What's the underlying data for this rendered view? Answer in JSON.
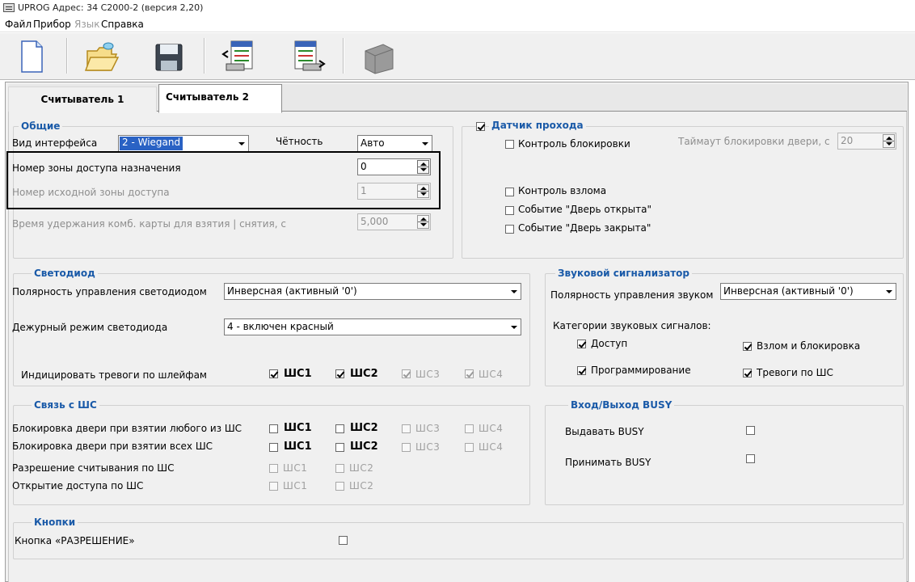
{
  "window": {
    "title": "UPROG Адрес: 34 С2000-2 (версия 2,20)"
  },
  "menu": [
    "Файл",
    "Прибор",
    "Язык",
    "Справка"
  ],
  "toolbar": {
    "buttons": [
      "new-document-icon",
      "open-folder-icon",
      "save-floppy-icon",
      "read-device-icon",
      "write-device-icon",
      "device-icon"
    ]
  },
  "tabs": [
    "Считыватель 1",
    "Считыватель 2"
  ],
  "general": {
    "title": "Общие",
    "interface_label": "Вид интерфейса",
    "interface_value": "2 - Wiegand",
    "parity_label": "Чётность",
    "parity_value": "Авто",
    "dest_zone_label": "Номер зоны доступа назначения",
    "dest_zone_value": "0",
    "src_zone_label": "Номер исходной зоны доступа",
    "src_zone_value": "1",
    "hold_time_label": "Время удержания комб. карты для взятия | снятия, с",
    "hold_time_value": "5,000"
  },
  "door_sensor": {
    "title": "Датчик прохода",
    "checked": true,
    "block_control": "Контроль блокировки",
    "timeout_label": "Таймаут блокировки двери, с",
    "timeout_value": "20",
    "break_control": "Контроль взлома",
    "event_open": "Событие \"Дверь открыта\"",
    "event_closed": "Событие \"Дверь закрыта\""
  },
  "led": {
    "title": "Светодиод",
    "polarity_label": "Полярность управления светодиодом",
    "polarity_value": "Инверсная (активный '0')",
    "standby_label": "Дежурный режим светодиода",
    "standby_value": "4 - включен красный",
    "alarms_label": "Индицировать тревоги по шлейфам",
    "loops": [
      {
        "label": "ШС1",
        "checked": true,
        "enabled": true
      },
      {
        "label": "ШС2",
        "checked": true,
        "enabled": true
      },
      {
        "label": "ШС3",
        "checked": true,
        "enabled": false
      },
      {
        "label": "ШС4",
        "checked": true,
        "enabled": false
      }
    ]
  },
  "buzzer": {
    "title": "Звуковой сигнализатор",
    "polarity_label": "Полярность управления звуком",
    "polarity_value": "Инверсная (активный '0')",
    "categories_label": "Категории звуковых сигналов:",
    "access": "Доступ",
    "break_block": "Взлом и блокировка",
    "programming": "Программирование",
    "alarms": "Тревоги по ШС"
  },
  "loops_link": {
    "title": "Связь с ШС",
    "row1": "Блокировка двери при взятии любого из ШС",
    "row2": "Блокировка двери при взятии всех ШС",
    "row3": "Разрешение считывания по ШС",
    "row4": "Открытие доступа по ШС",
    "l1": "ШС1",
    "l2": "ШС2",
    "l3": "ШС3",
    "l4": "ШС4"
  },
  "busy": {
    "title": "Вход/Выход BUSY",
    "out": "Выдавать BUSY",
    "in": "Принимать BUSY"
  },
  "buttons": {
    "title": "Кнопки",
    "permit": "Кнопка «РАЗРЕШЕНИЕ»"
  }
}
